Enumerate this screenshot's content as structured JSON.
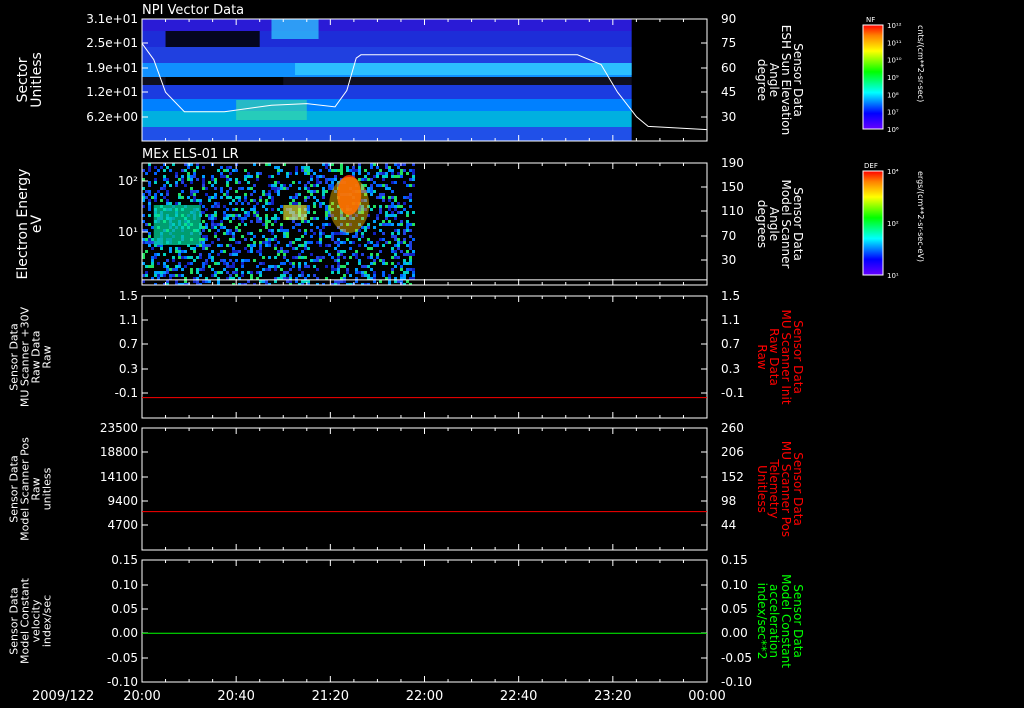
{
  "date_label": "2009/122",
  "time_ticks": [
    "20:00",
    "20:40",
    "21:20",
    "22:00",
    "22:40",
    "23:20",
    "00:00"
  ],
  "colors": {
    "background": "#000000",
    "axis": "#ffffff",
    "red_trace": "#ff0000",
    "green_trace": "#00ff00"
  },
  "panels": [
    {
      "id": "npi",
      "title": "NPI Vector Data",
      "left_label": [
        "Sector",
        "Unitless"
      ],
      "left_ticks": [
        "3.1e+01",
        "2.5e+01",
        "1.9e+01",
        "1.2e+01",
        "6.2e+00"
      ],
      "right_label": [
        "Sensor Data",
        "ESH Sun Elevation",
        "Angle",
        "degree"
      ],
      "right_ticks": [
        "90",
        "75",
        "60",
        "45",
        "30"
      ]
    },
    {
      "id": "els",
      "title": "MEx ELS-01 LR",
      "left_label": [
        "Electron Energy",
        "eV"
      ],
      "left_ticks": [
        "10²",
        "10¹"
      ],
      "right_label": [
        "Sensor Data",
        "Model Scanner",
        "Angle",
        "degrees"
      ],
      "right_ticks": [
        "190",
        "150",
        "110",
        "70",
        "30"
      ]
    },
    {
      "id": "mu_raw",
      "title": "",
      "left_label": [
        "Sensor Data",
        "MU Scanner +30V",
        "Raw Data",
        "Raw"
      ],
      "left_ticks": [
        "1.5",
        "1.1",
        "0.7",
        "0.3",
        "-0.1"
      ],
      "right_label": [
        "Sensor Data",
        "MU Scanner Init",
        "Raw Data",
        "Raw"
      ],
      "right_ticks": [
        "1.5",
        "1.1",
        "0.7",
        "0.3",
        "-0.1"
      ]
    },
    {
      "id": "mu_pos",
      "title": "",
      "left_label": [
        "Sensor Data",
        "Model Scanner Pos",
        "Raw",
        "unitless"
      ],
      "left_ticks": [
        "23500",
        "18800",
        "14100",
        "9400",
        "4700"
      ],
      "right_label": [
        "Sensor Data",
        "MU Scanner Pos",
        "Telemetry",
        "Unitless"
      ],
      "right_ticks": [
        "260",
        "206",
        "152",
        "98",
        "44"
      ]
    },
    {
      "id": "model_const",
      "title": "",
      "left_label": [
        "Sensor Data",
        "Model Constant",
        "velocity",
        "index/sec"
      ],
      "left_ticks": [
        "0.15",
        "0.10",
        "0.05",
        "0.00",
        "-0.05",
        "-0.10"
      ],
      "right_label": [
        "Sensor Data",
        "Model Constant",
        "acceleration",
        "index/sec**2"
      ],
      "right_ticks": [
        "0.15",
        "0.10",
        "0.05",
        "0.00",
        "-0.05",
        "-0.10"
      ]
    }
  ],
  "colorbars": [
    {
      "id": "nf",
      "label": "NF",
      "unit": "cnts/(cm**2-sr-sec)",
      "ticks": [
        "10¹²",
        "10¹¹",
        "10¹⁰",
        "10⁹",
        "10⁸",
        "10⁷",
        "10⁶"
      ]
    },
    {
      "id": "def",
      "label": "DEF",
      "unit": "ergs/(cm**2-sr-sec-eV)",
      "ticks": [
        "10⁴",
        "10²",
        "10¹"
      ]
    }
  ],
  "chart_data": [
    {
      "type": "heatmap",
      "title": "NPI Vector Data",
      "xlabel": "Time (2009/122)",
      "x": [
        "20:00",
        "20:40",
        "21:20",
        "22:00",
        "22:40",
        "23:20",
        "00:00"
      ],
      "xlim": [
        "20:00",
        "00:00"
      ],
      "ylabel": "Sector Unitless",
      "ylim": [
        0,
        31
      ],
      "overlay_line": {
        "name": "ESH Sun Elevation Angle (degree)",
        "axis": "right",
        "ylim": [
          15,
          90
        ],
        "points": [
          [
            "20:00",
            75
          ],
          [
            "20:05",
            65
          ],
          [
            "20:10",
            45
          ],
          [
            "20:18",
            33
          ],
          [
            "20:35",
            33
          ],
          [
            "20:55",
            37
          ],
          [
            "21:10",
            38
          ],
          [
            "21:22",
            36
          ],
          [
            "21:27",
            46
          ],
          [
            "21:31",
            66
          ],
          [
            "21:33",
            68
          ],
          [
            "23:05",
            68
          ],
          [
            "23:15",
            62
          ],
          [
            "23:22",
            45
          ],
          [
            "23:30",
            30
          ],
          [
            "23:35",
            24
          ],
          [
            "00:00",
            22
          ]
        ]
      }
    },
    {
      "type": "heatmap",
      "title": "MEx ELS-01 LR",
      "xlabel": "Time (2009/122)",
      "xlim": [
        "20:00",
        "00:00"
      ],
      "ylabel": "Electron Energy eV",
      "y_scale": "log",
      "y_data_until": "21:55",
      "overlay_line": {
        "name": "Model Scanner Angle (degrees)",
        "axis": "right",
        "ylim": [
          0,
          190
        ],
        "points": [
          [
            "20:00",
            8
          ],
          [
            "00:00",
            8
          ]
        ]
      }
    },
    {
      "type": "line",
      "xlim": [
        "20:00",
        "00:00"
      ],
      "ylim": [
        -0.3,
        1.5
      ],
      "series": [
        {
          "name": "MU Scanner +30V Raw Data",
          "color": "#ff0000",
          "x": [
            "20:00",
            "00:00"
          ],
          "values": [
            0.0,
            0.0
          ]
        }
      ]
    },
    {
      "type": "line",
      "xlim": [
        "20:00",
        "00:00"
      ],
      "ylim": [
        0,
        23500
      ],
      "series": [
        {
          "name": "Model Scanner Pos Raw",
          "color": "#ff0000",
          "x": [
            "20:00",
            "00:00"
          ],
          "values": [
            7400,
            7400
          ]
        }
      ]
    },
    {
      "type": "line",
      "xlim": [
        "20:00",
        "00:00"
      ],
      "ylim": [
        -0.1,
        0.15
      ],
      "series": [
        {
          "name": "Model Constant velocity",
          "color": "#00ff00",
          "x": [
            "20:00",
            "00:00"
          ],
          "values": [
            0.0,
            0.0
          ]
        }
      ]
    }
  ]
}
